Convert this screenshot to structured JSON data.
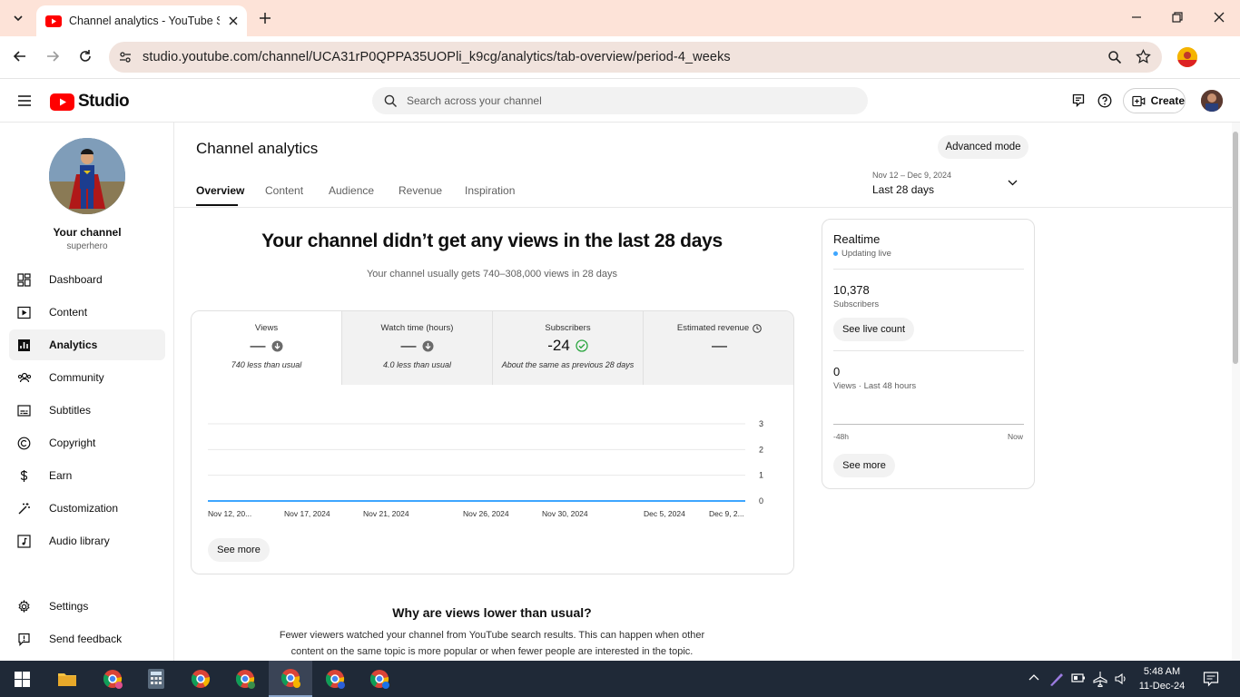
{
  "browser": {
    "tab_title": "Channel analytics - YouTube Studio",
    "url": "studio.youtube.com/channel/UCA31rP0QPPA35UOPli_k9cg/analytics/tab-overview/period-4_weeks"
  },
  "header": {
    "logo_text": "Studio",
    "search_placeholder": "Search across your channel",
    "create_label": "Create"
  },
  "sidebar": {
    "channel_name": "Your channel",
    "channel_handle": "superhero",
    "items": [
      {
        "label": "Dashboard",
        "icon": "dashboard-icon"
      },
      {
        "label": "Content",
        "icon": "content-icon"
      },
      {
        "label": "Analytics",
        "icon": "analytics-icon",
        "active": true
      },
      {
        "label": "Community",
        "icon": "community-icon"
      },
      {
        "label": "Subtitles",
        "icon": "subtitles-icon"
      },
      {
        "label": "Copyright",
        "icon": "copyright-icon"
      },
      {
        "label": "Earn",
        "icon": "dollar-icon"
      },
      {
        "label": "Customization",
        "icon": "magic-wand-icon"
      },
      {
        "label": "Audio library",
        "icon": "audio-library-icon"
      }
    ],
    "bottom_items": [
      {
        "label": "Settings",
        "icon": "gear-icon"
      },
      {
        "label": "Send feedback",
        "icon": "feedback-icon"
      }
    ]
  },
  "main": {
    "title": "Channel analytics",
    "advanced_mode": "Advanced mode",
    "tabs": [
      "Overview",
      "Content",
      "Audience",
      "Revenue",
      "Inspiration"
    ],
    "active_tab": "Overview",
    "date_range": "Nov 12 – Dec 9, 2024",
    "date_label": "Last 28 days",
    "headline": "Your channel didn’t get any views in the last 28 days",
    "subline": "Your channel usually gets 740–308,000 views in 28 days",
    "metrics": [
      {
        "title": "Views",
        "value": "—",
        "sub": "740 less than usual"
      },
      {
        "title": "Watch time (hours)",
        "value": "—",
        "sub": "4.0 less than usual"
      },
      {
        "title": "Subscribers",
        "value": "-24",
        "sub": "About the same as previous 28 days"
      },
      {
        "title": "Estimated revenue",
        "value": "—",
        "sub": ""
      }
    ],
    "see_more": "See more",
    "why_title": "Why are views lower than usual?",
    "why_text": "Fewer viewers watched your channel from YouTube search results. This can happen when other content on the same topic is more popular or when fewer people are interested in the topic."
  },
  "chart_data": {
    "type": "line",
    "x_ticks": [
      "Nov 12, 20...",
      "Nov 17, 2024",
      "Nov 21, 2024",
      "Nov 26, 2024",
      "Nov 30, 2024",
      "Dec 5, 2024",
      "Dec 9, 2..."
    ],
    "y_ticks": [
      "3",
      "2",
      "1",
      "0"
    ],
    "ylim": [
      0,
      3
    ],
    "series": [
      {
        "values": [
          0,
          0,
          0,
          0,
          0,
          0,
          0,
          0,
          0,
          0,
          0,
          0,
          0,
          0,
          0,
          0,
          0,
          0,
          0,
          0,
          0,
          0,
          0,
          0,
          0,
          0,
          0,
          0
        ]
      }
    ],
    "line_color": "#3ea6ff",
    "grid": true
  },
  "realtime": {
    "title": "Realtime",
    "status": "Updating live",
    "subscribers": "10,378",
    "subscribers_label": "Subscribers",
    "live_count_btn": "See live count",
    "views": "0",
    "views_label": "Views · Last 48 hours",
    "axis_start": "-48h",
    "axis_end": "Now",
    "see_more": "See more"
  },
  "taskbar": {
    "time": "5:48 AM",
    "date": "11-Dec-24"
  },
  "colors": {
    "youtube_red": "#ff0000",
    "tabbar_bg": "#fde3d8",
    "accent_blue": "#3ea6ff",
    "green_check": "#2ba640"
  }
}
